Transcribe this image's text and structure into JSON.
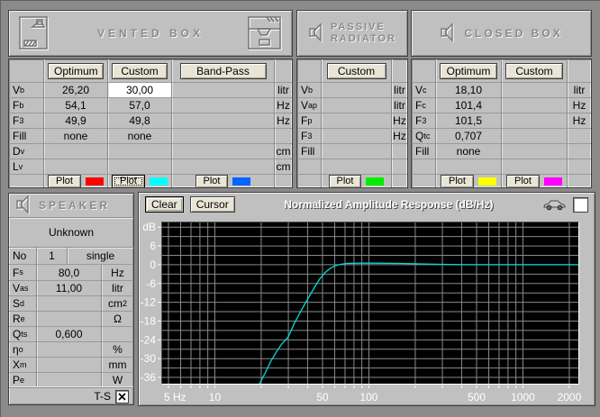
{
  "panels": {
    "vented": {
      "title": "VENTED BOX",
      "buttons": {
        "optimum": "Optimum",
        "custom": "Custom",
        "bandpass": "Band-Pass"
      },
      "rows": [
        {
          "label": {
            "base": "V",
            "sub": "b"
          },
          "optimum": "26,20",
          "custom": "30,00",
          "bandpass": "",
          "unit": "litr"
        },
        {
          "label": {
            "base": "F",
            "sub": "b"
          },
          "optimum": "54,1",
          "custom": "57,0",
          "bandpass": "",
          "unit": "Hz"
        },
        {
          "label": {
            "base": "F",
            "sub": "3"
          },
          "optimum": "49,9",
          "custom": "49,8",
          "bandpass": "",
          "unit": "Hz"
        },
        {
          "label": {
            "base": "Fill",
            "sub": ""
          },
          "optimum": "none",
          "custom": "none",
          "bandpass": "",
          "unit": ""
        },
        {
          "label": {
            "base": "D",
            "sub": "v"
          },
          "optimum": "",
          "custom": "",
          "bandpass": "",
          "unit": "cm"
        },
        {
          "label": {
            "base": "L",
            "sub": "v"
          },
          "optimum": "",
          "custom": "",
          "bandpass": "",
          "unit": "cm"
        }
      ],
      "plot": {
        "label": "Plot",
        "optimum_color": "#ff0000",
        "custom_color": "#00ffff",
        "bandpass_color": "#0066ff"
      }
    },
    "passive": {
      "title_line1": "PASSIVE",
      "title_line2": "RADIATOR",
      "buttons": {
        "custom": "Custom"
      },
      "rows": [
        {
          "label": {
            "base": "V",
            "sub": "b"
          },
          "value": "",
          "unit": "litr"
        },
        {
          "label": {
            "base": "V",
            "sub": "ap"
          },
          "value": "",
          "unit": "litr"
        },
        {
          "label": {
            "base": "F",
            "sub": "p"
          },
          "value": "",
          "unit": "Hz"
        },
        {
          "label": {
            "base": "F",
            "sub": "3"
          },
          "value": "",
          "unit": "Hz"
        },
        {
          "label": {
            "base": "Fill",
            "sub": ""
          },
          "value": "",
          "unit": ""
        }
      ],
      "plot": {
        "label": "Plot",
        "color": "#00ee00"
      }
    },
    "closed": {
      "title": "CLOSED BOX",
      "buttons": {
        "optimum": "Optimum",
        "custom": "Custom"
      },
      "rows": [
        {
          "label": {
            "base": "V",
            "sub": "c"
          },
          "optimum": "18,10",
          "custom": "",
          "unit": "litr"
        },
        {
          "label": {
            "base": "F",
            "sub": "c"
          },
          "optimum": "101,4",
          "custom": "",
          "unit": "Hz"
        },
        {
          "label": {
            "base": "F",
            "sub": "3"
          },
          "optimum": "101,5",
          "custom": "",
          "unit": "Hz"
        },
        {
          "label": {
            "base": "Q",
            "sub": "tc"
          },
          "optimum": "0,707",
          "custom": "",
          "unit": ""
        },
        {
          "label": {
            "base": "Fill",
            "sub": ""
          },
          "optimum": "none",
          "custom": "",
          "unit": ""
        }
      ],
      "plot": {
        "label": "Plot",
        "optimum_color": "#ffff00",
        "custom_color": "#ff00ff"
      }
    },
    "speaker": {
      "title": "SPEAKER",
      "name": "Unknown",
      "no_row": {
        "label": "No",
        "number": "1",
        "mode": "single"
      },
      "rows": [
        {
          "label": {
            "base": "F",
            "sub": "s"
          },
          "value": "80,0",
          "unit": {
            "base": "Hz",
            "sup": ""
          }
        },
        {
          "label": {
            "base": "V",
            "sub": "as"
          },
          "value": "11,00",
          "unit": {
            "base": "litr",
            "sup": ""
          }
        },
        {
          "label": {
            "base": "S",
            "sub": "d"
          },
          "value": "",
          "unit": {
            "base": "cm",
            "sup": "2"
          }
        },
        {
          "label": {
            "base": "R",
            "sub": "e"
          },
          "value": "",
          "unit": {
            "base": "Ω",
            "sup": ""
          }
        },
        {
          "label": {
            "base": "Q",
            "sub": "ts"
          },
          "value": "0,600",
          "unit": {
            "base": "",
            "sup": ""
          }
        },
        {
          "label": {
            "base": "η",
            "sub": "o"
          },
          "value": "",
          "unit": {
            "base": "%",
            "sup": ""
          }
        },
        {
          "label": {
            "base": "X",
            "sub": "m"
          },
          "value": "",
          "unit": {
            "base": "mm",
            "sup": ""
          }
        },
        {
          "label": {
            "base": "P",
            "sub": "e"
          },
          "value": "",
          "unit": {
            "base": "W",
            "sup": ""
          }
        }
      ],
      "ts_label": "T-S",
      "ts_checked": true
    }
  },
  "chart": {
    "clear_label": "Clear",
    "cursor_label": "Cursor",
    "title": "Normalized Amplitude Response (dB/Hz)"
  },
  "chart_data": {
    "type": "line",
    "title": "Normalized Amplitude Response (dB/Hz)",
    "x_scale": "log",
    "xlabel": "Hz",
    "ylabel": "dB",
    "xlim": [
      4.55,
      2290
    ],
    "ylim": [
      -38,
      13.5
    ],
    "plot_bg": "#000000",
    "grid_color": "#8a8a8a",
    "x_gridlines": [
      5,
      6,
      7,
      8,
      9,
      10,
      20,
      30,
      40,
      50,
      60,
      70,
      80,
      90,
      100,
      200,
      300,
      400,
      500,
      600,
      700,
      800,
      900,
      1000,
      2000
    ],
    "x_tick_labels": [
      {
        "f": 5,
        "text": "5 Hz"
      },
      {
        "f": 10,
        "text": "10"
      },
      {
        "f": 50,
        "text": "50"
      },
      {
        "f": 100,
        "text": "100"
      },
      {
        "f": 500,
        "text": "500"
      },
      {
        "f": 1000,
        "text": "1000"
      },
      {
        "f": 2000,
        "text": "2000"
      }
    ],
    "y_grid_min": -36,
    "y_grid_max": 12,
    "y_grid_step": 3,
    "y_tick_labels": [
      {
        "db": 12,
        "text": "dB"
      },
      {
        "db": 6,
        "text": "6"
      },
      {
        "db": 0,
        "text": "0"
      },
      {
        "db": -6,
        "text": "-6"
      },
      {
        "db": -12,
        "text": "-12"
      },
      {
        "db": -18,
        "text": "-18"
      },
      {
        "db": -24,
        "text": "-24"
      },
      {
        "db": -30,
        "text": "-30"
      },
      {
        "db": -36,
        "text": "-36"
      }
    ],
    "series": [
      {
        "name": "vented-box-custom",
        "color": "#00dcdc",
        "points": [
          [
            19.5,
            -38
          ],
          [
            21,
            -35
          ],
          [
            23,
            -31
          ],
          [
            25,
            -28
          ],
          [
            27,
            -25.5
          ],
          [
            30,
            -23
          ],
          [
            33,
            -18.5
          ],
          [
            36,
            -15
          ],
          [
            40,
            -11
          ],
          [
            44,
            -7.5
          ],
          [
            48,
            -4.5
          ],
          [
            52,
            -2.5
          ],
          [
            56,
            -1.2
          ],
          [
            60,
            -0.4
          ],
          [
            65,
            0.1
          ],
          [
            72,
            0.4
          ],
          [
            85,
            0.5
          ],
          [
            110,
            0.5
          ],
          [
            160,
            0.4
          ],
          [
            230,
            0.25
          ],
          [
            330,
            0.1
          ],
          [
            450,
            0
          ],
          [
            2290,
            0
          ]
        ]
      }
    ]
  }
}
